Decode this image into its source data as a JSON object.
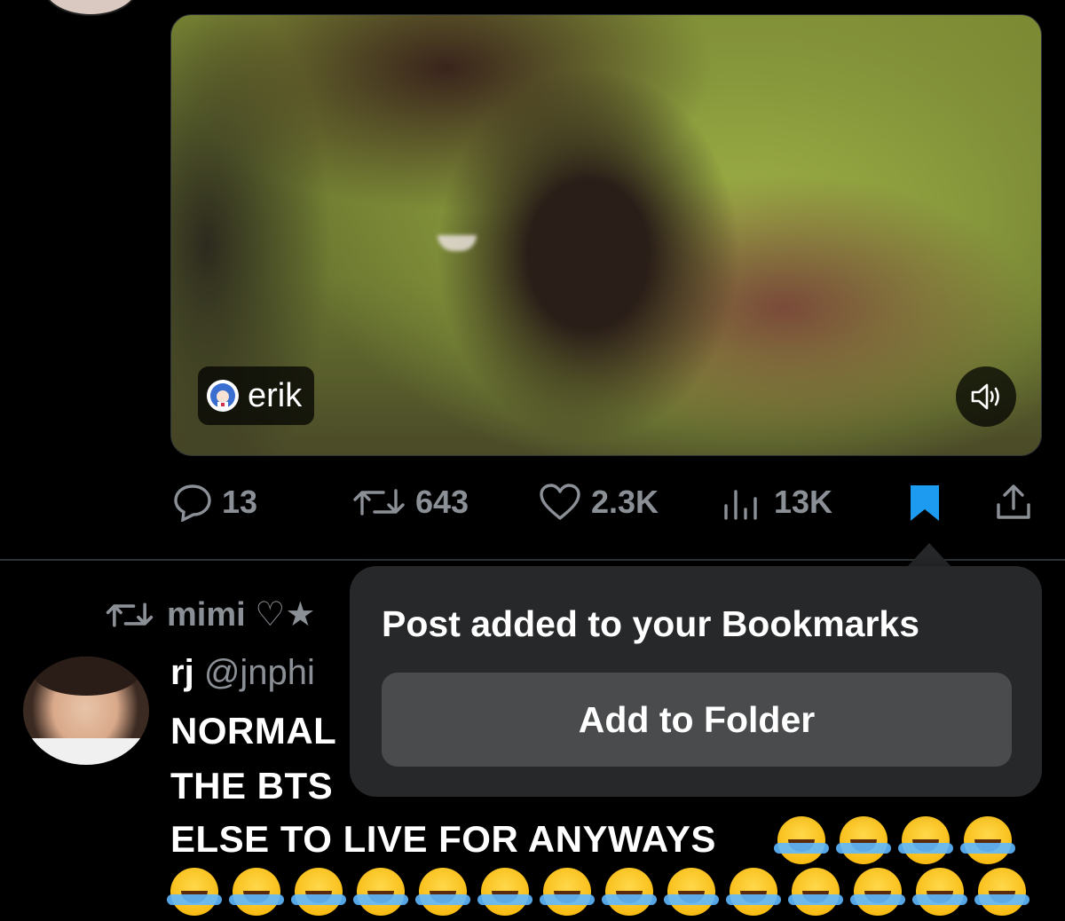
{
  "media": {
    "author_name": "erik",
    "icons": {
      "author_avatar": "anime-avatar-icon",
      "sound": "speaker-icon"
    }
  },
  "actions": {
    "replies": "13",
    "reposts": "643",
    "likes": "2.3K",
    "views": "13K",
    "icons": [
      "reply-icon",
      "repost-icon",
      "like-icon",
      "views-icon",
      "bookmark-icon",
      "share-icon"
    ],
    "bookmark_color": "#1d9bf0"
  },
  "next_tweet": {
    "retweeted_by": "mimi ♡★",
    "display_name": "rj",
    "handle_partial": "@jnphi",
    "line1": "NORMAL",
    "line2": "THE BTS",
    "line3": "ELSE TO LIVE FOR ANYWAYS",
    "emoji_name": "face-with-tears-of-joy-icon"
  },
  "toast": {
    "message": "Post added to your Bookmarks",
    "button_label": "Add to Folder"
  }
}
